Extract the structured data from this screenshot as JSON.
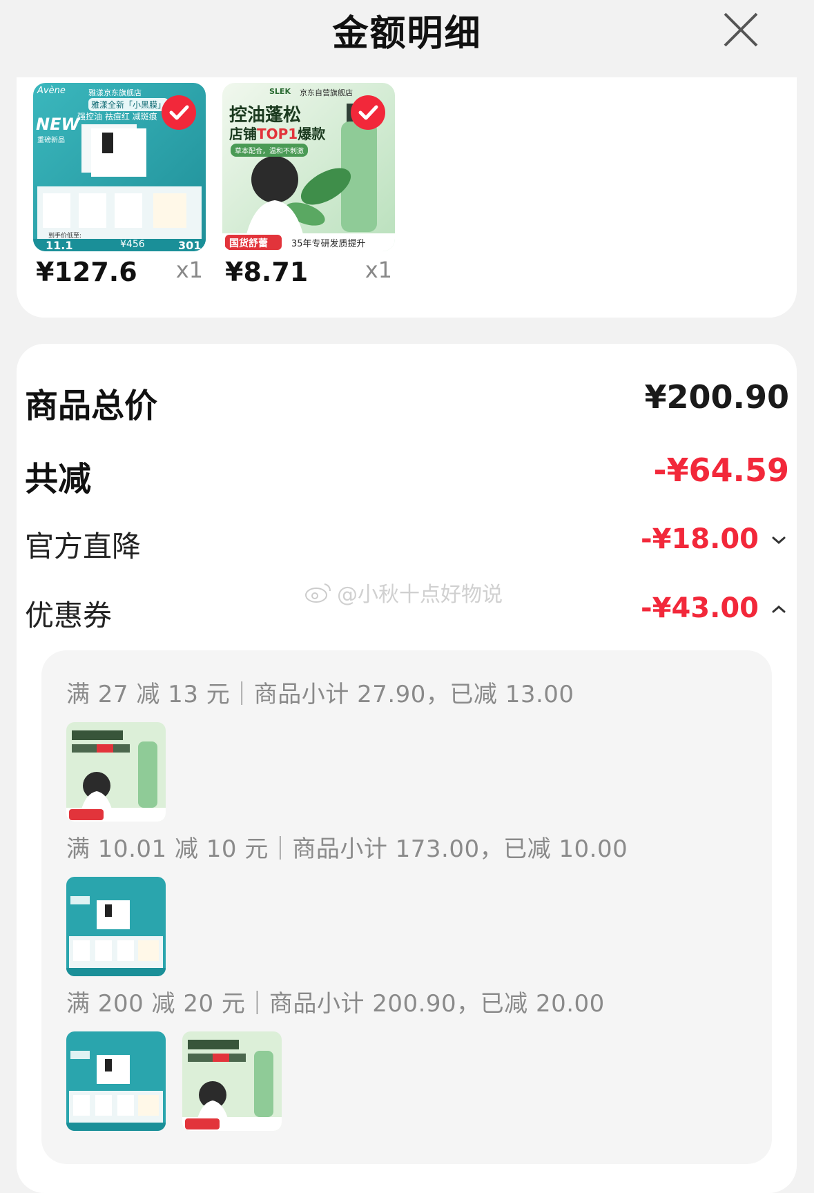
{
  "header": {
    "title": "金额明细"
  },
  "products": [
    {
      "price": "¥127.6",
      "qty": "x1",
      "image": {
        "brand": "Avène",
        "store": "雅漾京东旗舰店",
        "tag": "雅漾全新「小黑膜」",
        "sub": "强控油 祛痘红 减斑痕",
        "badge": "NEW",
        "badge_sub": "重磅新品",
        "promo": "到手价低至:",
        "price_a": "11.1",
        "price_b": "¥456",
        "price_c": "301"
      }
    },
    {
      "price": "¥8.71",
      "qty": "x1",
      "image": {
        "brand": "SLEK",
        "store": "京东自营旗舰店",
        "line1": "控油蓬松",
        "line2": "店铺",
        "line2_hl": "TOP1",
        "line3": "爆款",
        "sub": "草本配合，温和不刺激",
        "footer_red": "国货舒蕾",
        "footer_white": "35年专研发质提升"
      }
    }
  ],
  "summary": {
    "total_label": "商品总价",
    "total_value": "¥200.90",
    "reduce_label": "共减",
    "reduce_value": "-¥64.59",
    "official_label": "官方直降",
    "official_value": "-¥18.00",
    "coupon_label": "优惠券",
    "coupon_value": "-¥43.00"
  },
  "watermark": "@小秋十点好物说",
  "coupons": [
    {
      "text": "满 27 减 13 元｜商品小计 27.90，已减 13.00"
    },
    {
      "text": "满 10.01 减 10 元｜商品小计 173.00，已减 10.00"
    },
    {
      "text": "满 200 减 20 元｜商品小计 200.90，已减 20.00"
    }
  ],
  "colors": {
    "accent_red": "#f2283a",
    "avene_teal": "#2aa5ad",
    "slek_green": "#9fd3a6"
  }
}
